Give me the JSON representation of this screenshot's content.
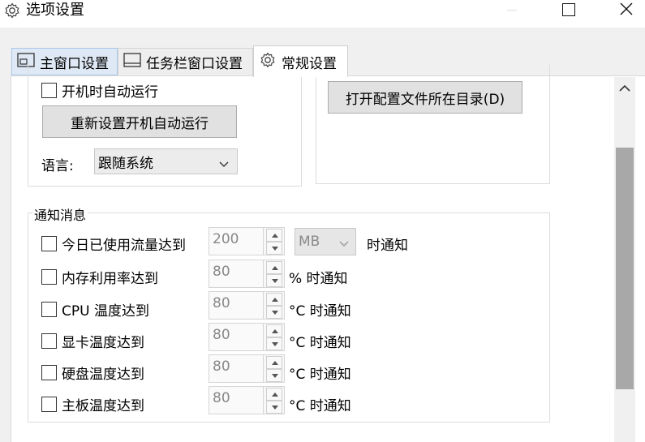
{
  "window": {
    "title": "选项设置",
    "icon": "gear-icon",
    "controls": [
      "minimize-icon",
      "maximize-icon",
      "close-icon"
    ]
  },
  "tabs": [
    {
      "label": "主窗口设置",
      "icon": "main-window-icon",
      "selected": false
    },
    {
      "label": "任务栏窗口设置",
      "icon": "taskbar-window-icon",
      "selected": false
    },
    {
      "label": "常规设置",
      "icon": "gear-icon",
      "selected": true
    }
  ],
  "startup": {
    "autorun_label": "开机时自动运行",
    "autorun_checked": false,
    "reset_button": "重新设置开机自动运行",
    "language_label": "语言:",
    "language_value": "跟随系统"
  },
  "config": {
    "open_dir_button": "打开配置文件所在目录(D)"
  },
  "notify": {
    "legend": "通知消息",
    "items": [
      {
        "label": "今日已使用流量达到",
        "value": "200",
        "unit_select": "MB",
        "suffix": "时通知",
        "checked": false
      },
      {
        "label": "内存利用率达到",
        "value": "80",
        "suffix": "% 时通知",
        "checked": false
      },
      {
        "label": "CPU 温度达到",
        "value": "80",
        "suffix": "°C 时通知",
        "checked": false
      },
      {
        "label": "显卡温度达到",
        "value": "80",
        "suffix": "°C 时通知",
        "checked": false
      },
      {
        "label": "硬盘温度达到",
        "value": "80",
        "suffix": "°C 时通知",
        "checked": false
      },
      {
        "label": "主板温度达到",
        "value": "80",
        "suffix": "°C 时通知",
        "checked": false
      }
    ]
  },
  "colors": {
    "selected_tab_bg": "#ffffff",
    "hover_tab_bg": "#dfe9f5",
    "button_bg": "#e1e1e1",
    "scroll_thumb": "#a8a8a8"
  }
}
